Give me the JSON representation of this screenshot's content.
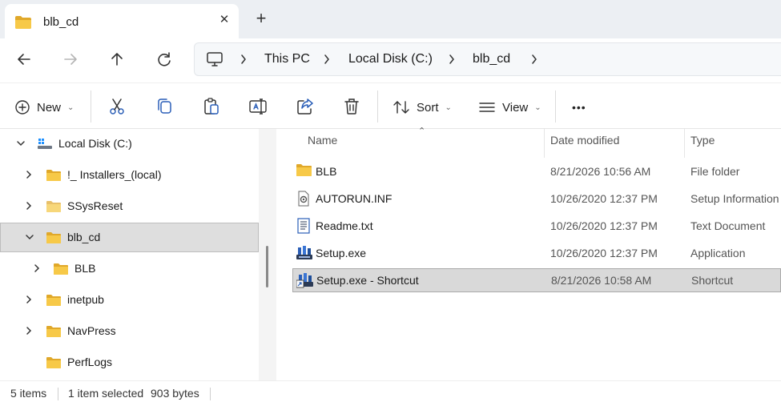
{
  "tab": {
    "title": "blb_cd",
    "close_glyph": "✕",
    "new_tab_glyph": "+"
  },
  "nav": {
    "back_icon": "back-arrow-icon",
    "forward_icon": "forward-arrow-icon",
    "up_icon": "up-arrow-icon",
    "refresh_icon": "refresh-icon"
  },
  "breadcrumb": {
    "items": [
      "This PC",
      "Local Disk (C:)",
      "blb_cd"
    ]
  },
  "commands": {
    "new_label": "New",
    "sort_label": "Sort",
    "view_label": "View",
    "more_label": "•••"
  },
  "tree": [
    {
      "label": "Local Disk (C:)",
      "expanded": true
    },
    {
      "label": "!_ Installers_(local)",
      "expanded": false
    },
    {
      "label": "SSysReset",
      "expanded": false
    },
    {
      "label": "blb_cd",
      "expanded": true,
      "selected": true
    },
    {
      "label": "BLB",
      "expanded": false
    },
    {
      "label": "inetpub",
      "expanded": false
    },
    {
      "label": "NavPress",
      "expanded": false
    },
    {
      "label": "PerfLogs",
      "expanded": null
    }
  ],
  "columns": {
    "name": "Name",
    "date": "Date modified",
    "type": "Type"
  },
  "files": [
    {
      "name": "BLB",
      "date": "8/21/2026 10:56 AM",
      "type": "File folder",
      "icon": "folder-icon"
    },
    {
      "name": "AUTORUN.INF",
      "date": "10/26/2020 12:37 PM",
      "type": "Setup Information",
      "icon": "setup-info-file-icon"
    },
    {
      "name": "Readme.txt",
      "date": "10/26/2020 12:37 PM",
      "type": "Text Document",
      "icon": "text-document-icon"
    },
    {
      "name": "Setup.exe",
      "date": "10/26/2020 12:37 PM",
      "type": "Application",
      "icon": "setup-application-icon"
    },
    {
      "name": "Setup.exe - Shortcut",
      "date": "8/21/2026 10:58 AM",
      "type": "Shortcut",
      "icon": "shortcut-icon",
      "selected": true
    }
  ],
  "status": {
    "item_count": "5 items",
    "selection": "1 item selected",
    "size": "903 bytes"
  },
  "colors": {
    "folder": "#f4c542",
    "folder_dark": "#e0a82a",
    "selection": "#d9d9d9",
    "accent_blue": "#2b5fb8"
  }
}
